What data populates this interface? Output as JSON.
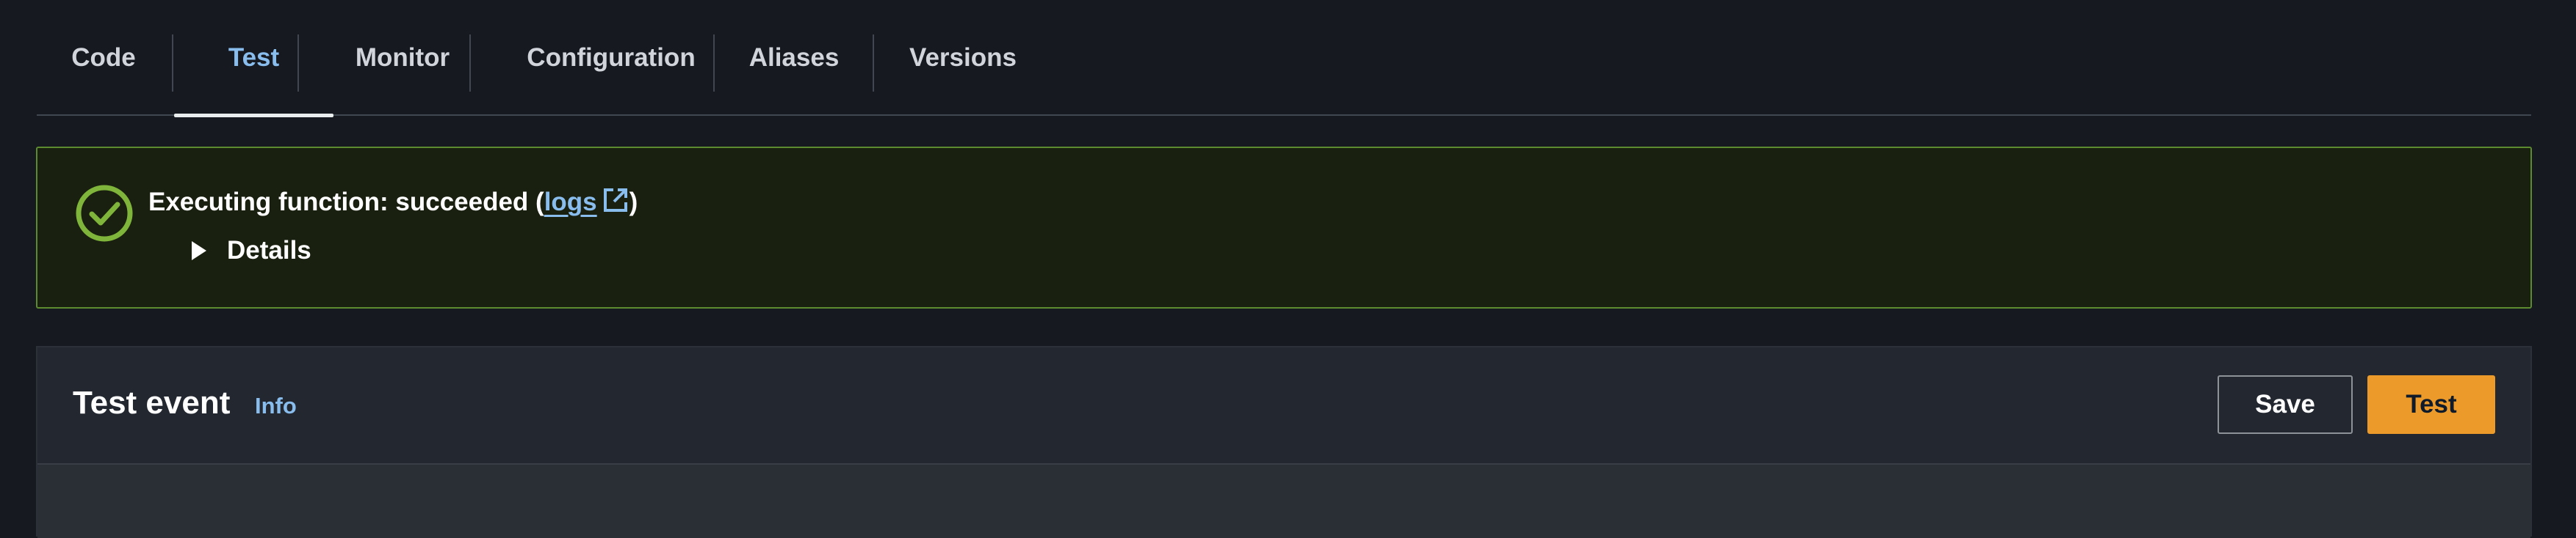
{
  "tabs": [
    {
      "label": "Code"
    },
    {
      "label": "Test"
    },
    {
      "label": "Monitor"
    },
    {
      "label": "Configuration"
    },
    {
      "label": "Aliases"
    },
    {
      "label": "Versions"
    }
  ],
  "active_tab": "Test",
  "alert": {
    "status": "success",
    "title_prefix": "Executing function: succeeded (",
    "link_label": "logs",
    "title_suffix": ")",
    "details_label": "Details"
  },
  "panel": {
    "title": "Test event",
    "info_label": "Info",
    "save_label": "Save",
    "test_label": "Test"
  },
  "colors": {
    "background": "#16191f",
    "accent_link": "#89bdee",
    "success_border": "#5b8a2f",
    "success_icon": "#7fb53a",
    "primary_button": "#ec9b2b"
  },
  "icons": {
    "success": "check-circle-icon",
    "external_link": "external-link-icon",
    "expand": "caret-right-icon"
  }
}
